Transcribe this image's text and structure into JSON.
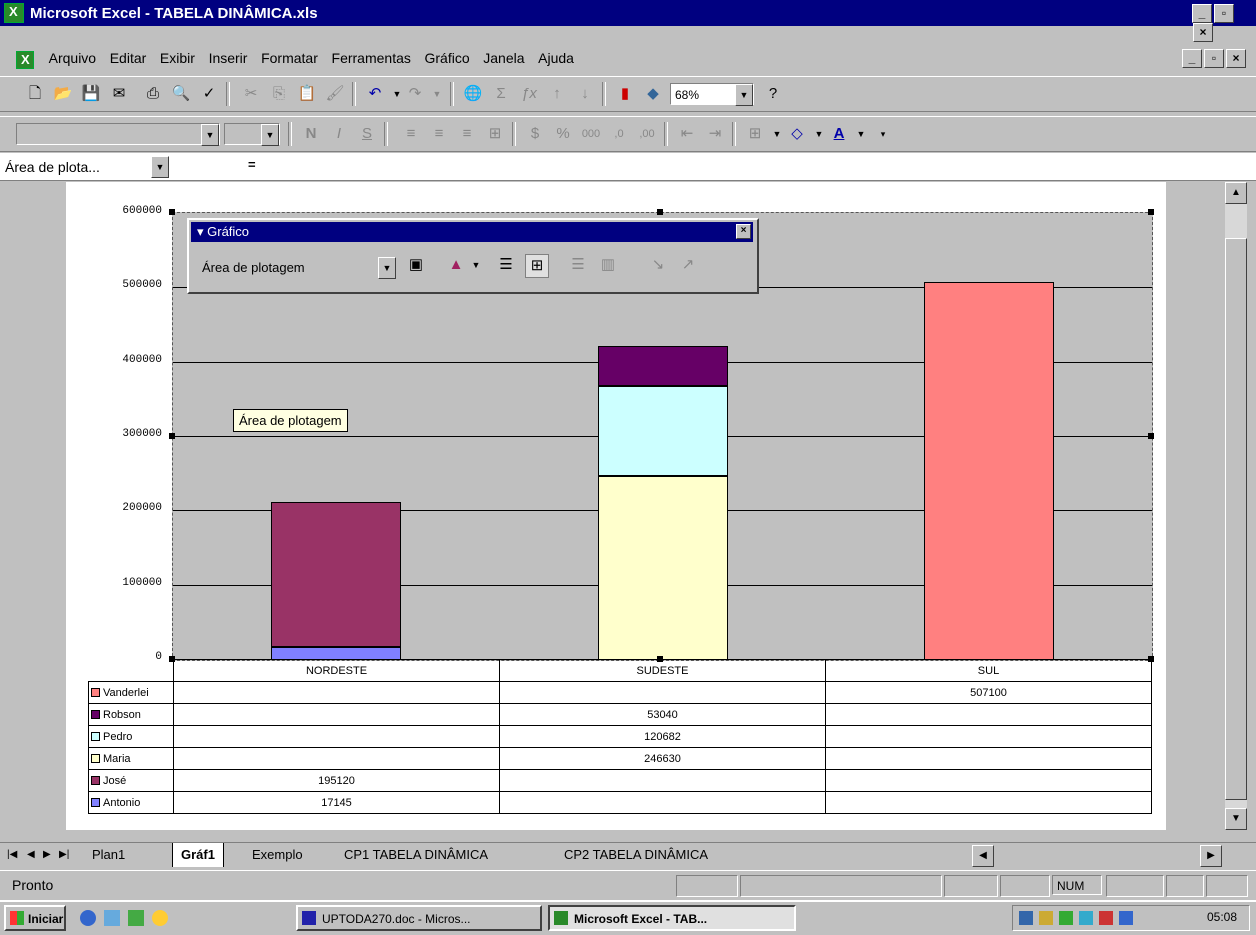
{
  "window": {
    "title": "Microsoft Excel - TABELA DINÂMICA.xls",
    "min": "_",
    "max": "▫",
    "close": "×"
  },
  "menu": [
    "Arquivo",
    "Editar",
    "Exibir",
    "Inserir",
    "Formatar",
    "Ferramentas",
    "Gráfico",
    "Janela",
    "Ajuda"
  ],
  "toolbar": {
    "zoom": "68%"
  },
  "namebox": {
    "value": "Área de plota...",
    "equals": "="
  },
  "chart_data": {
    "type": "bar",
    "stacked": true,
    "categories": [
      "NORDESTE",
      "SUDESTE",
      "SUL"
    ],
    "ylim": [
      0,
      600000
    ],
    "yticks": [
      "600000",
      "500000",
      "400000",
      "300000",
      "200000",
      "100000",
      "0"
    ],
    "series": [
      {
        "name": "Antonio",
        "color": "#8080ff",
        "values": [
          17145,
          null,
          null
        ]
      },
      {
        "name": "José",
        "color": "#993366",
        "values": [
          195120,
          null,
          null
        ]
      },
      {
        "name": "Maria",
        "color": "#ffffcc",
        "values": [
          null,
          246630,
          null
        ]
      },
      {
        "name": "Pedro",
        "color": "#ccffff",
        "values": [
          null,
          120682,
          null
        ]
      },
      {
        "name": "Robson",
        "color": "#660066",
        "values": [
          null,
          53040,
          null
        ]
      },
      {
        "name": "Vanderlei",
        "color": "#ff8080",
        "values": [
          null,
          null,
          507100
        ]
      }
    ],
    "table_rows": [
      {
        "label": "Vanderlei",
        "cells": [
          "",
          "",
          "507100"
        ]
      },
      {
        "label": "Robson",
        "cells": [
          "",
          "53040",
          ""
        ]
      },
      {
        "label": "Pedro",
        "cells": [
          "",
          "120682",
          ""
        ]
      },
      {
        "label": "Maria",
        "cells": [
          "",
          "246630",
          ""
        ]
      },
      {
        "label": "José",
        "cells": [
          "195120",
          "",
          ""
        ]
      },
      {
        "label": "Antonio",
        "cells": [
          "17145",
          "",
          ""
        ]
      }
    ],
    "legend": "data-table-left",
    "grid": true
  },
  "chart_toolbar": {
    "title": "Gráfico",
    "object_select": "Área de plotagem"
  },
  "tooltip": "Área de plotagem",
  "tabs": [
    "Plan1",
    "Gráf1",
    "Exemplo",
    "CP1 TABELA DINÂMICA",
    "CP2 TABELA DINÂMICA"
  ],
  "status": {
    "text": "Pronto",
    "num": "NUM"
  },
  "taskbar": {
    "start": "Iniciar",
    "items": [
      "UPTODA270.doc - Micros...",
      "Microsoft Excel - TAB..."
    ],
    "clock": "05:08"
  }
}
